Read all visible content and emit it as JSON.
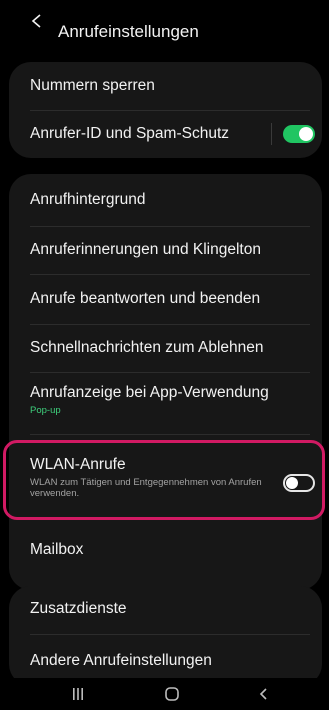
{
  "header": {
    "back_icon": "chevron-left-icon",
    "title": "Anrufeinstellungen"
  },
  "group1": {
    "block_numbers": "Nummern sperren",
    "caller_id": "Anrufer-ID und Spam-Schutz",
    "caller_id_enabled": true
  },
  "group2": {
    "background": "Anrufhintergrund",
    "alerts_ringtone": "Anruferinnerungen und Klingelton",
    "answer_end": "Anrufe beantworten und beenden",
    "quick_decline": "Schnellnachrichten zum Ablehnen",
    "display_while_using_apps": "Anrufanzeige bei App-Verwendung",
    "display_while_using_apps_value": "Pop-up",
    "wifi_calling": "WLAN-Anrufe",
    "wifi_calling_desc": "WLAN zum Tätigen und Entgegennehmen von Anrufen verwenden.",
    "wifi_calling_enabled": false,
    "voicemail": "Mailbox"
  },
  "group3": {
    "supplementary": "Zusatzdienste",
    "other": "Andere Anrufeinstellungen"
  },
  "colors": {
    "accent_green": "#20c562",
    "highlight": "#d11a63",
    "card_bg": "#171717"
  },
  "navbar": {
    "recent_icon": "recent-apps-icon",
    "home_icon": "home-icon",
    "back_icon": "back-icon"
  }
}
